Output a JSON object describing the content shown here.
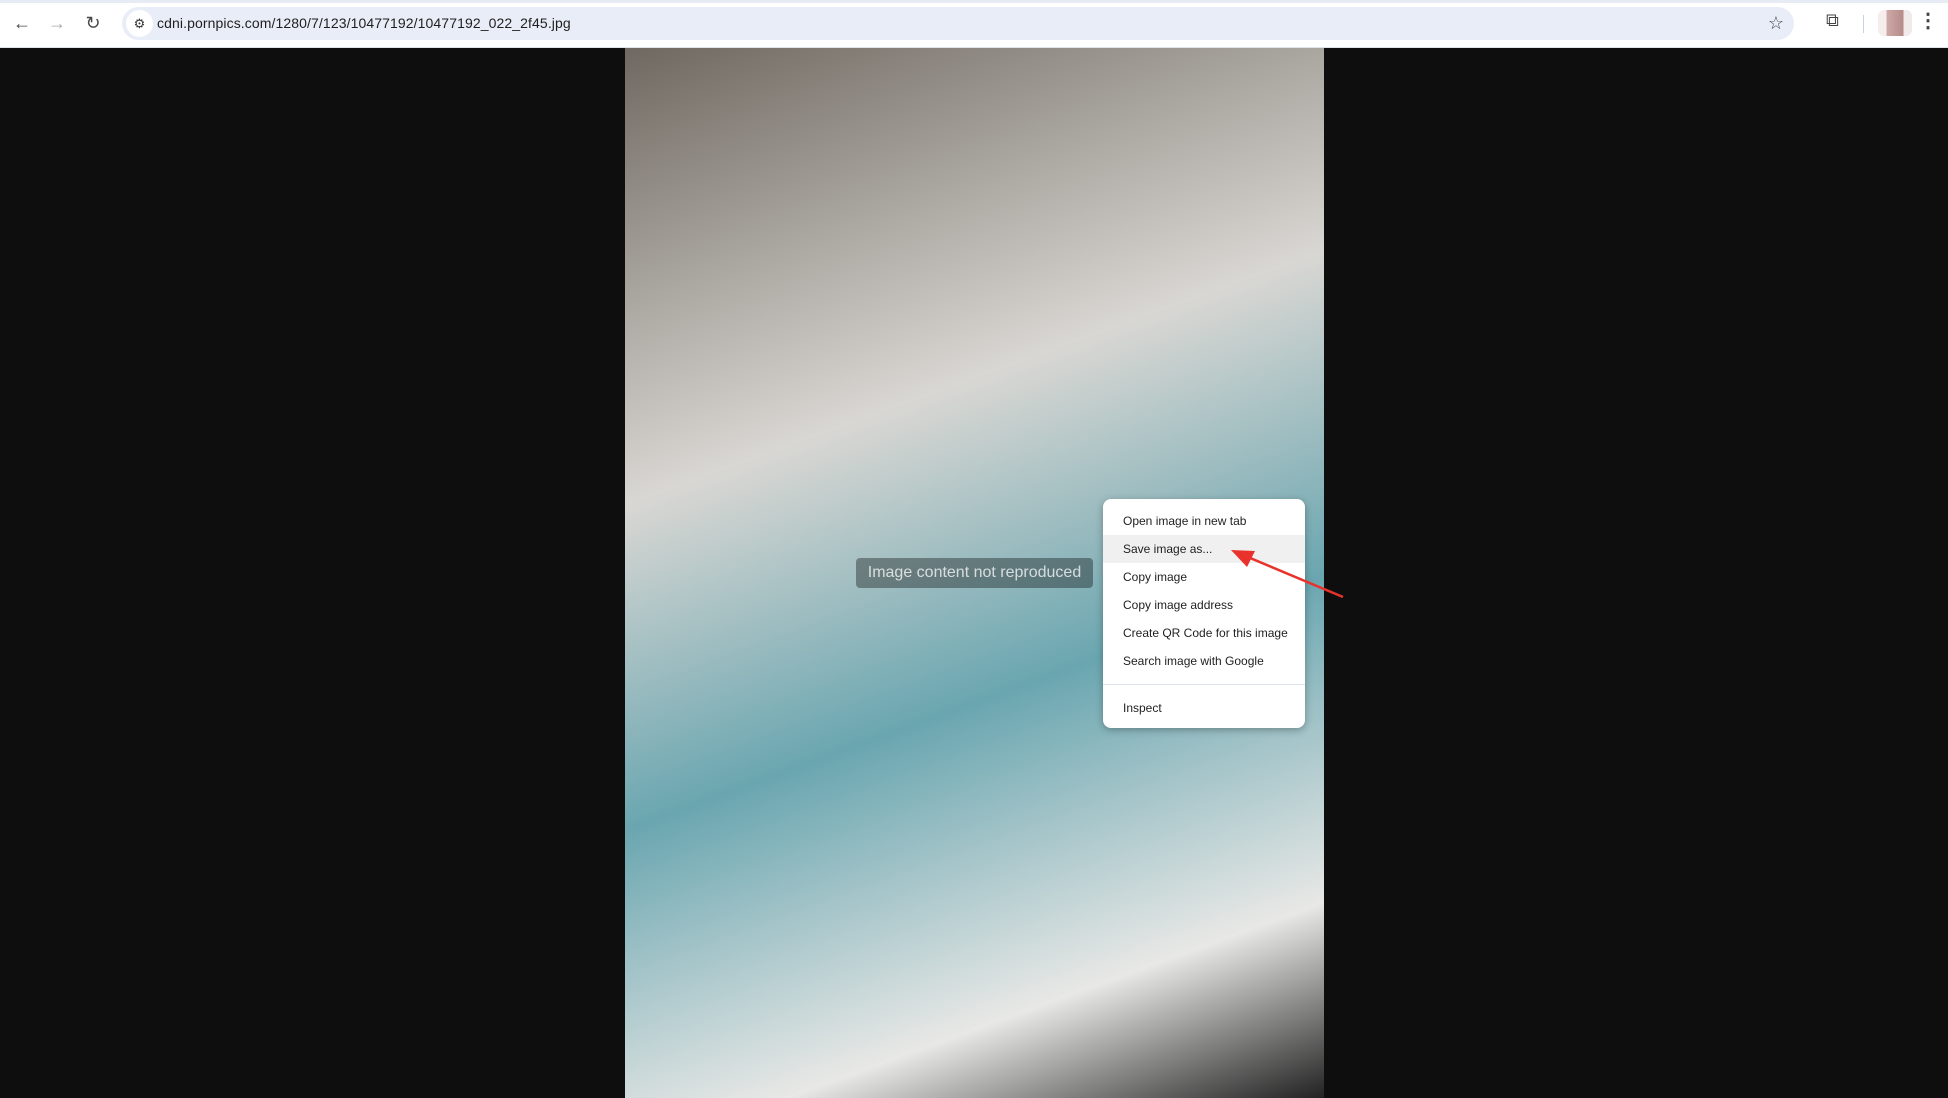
{
  "browser": {
    "url": "cdni.pornpics.com/1280/7/123/10477192/10477192_022_2f45.jpg",
    "nav_icons": {
      "back": "←",
      "forward": "→",
      "reload": "↻",
      "site_info": "⚙",
      "bookmark": "☆",
      "extensions": "⧉",
      "menu": "⋮"
    }
  },
  "content": {
    "placeholder": "Image content not reproduced"
  },
  "context_menu": {
    "items": [
      {
        "label": "Open image in new tab"
      },
      {
        "label": "Save image as..."
      },
      {
        "label": "Copy image"
      },
      {
        "label": "Copy image address"
      },
      {
        "label": "Create QR Code for this image"
      },
      {
        "label": "Search image with Google"
      },
      {
        "label": "Inspect"
      }
    ],
    "highlighted_index": 1,
    "annotation_color": "#e8322b"
  }
}
